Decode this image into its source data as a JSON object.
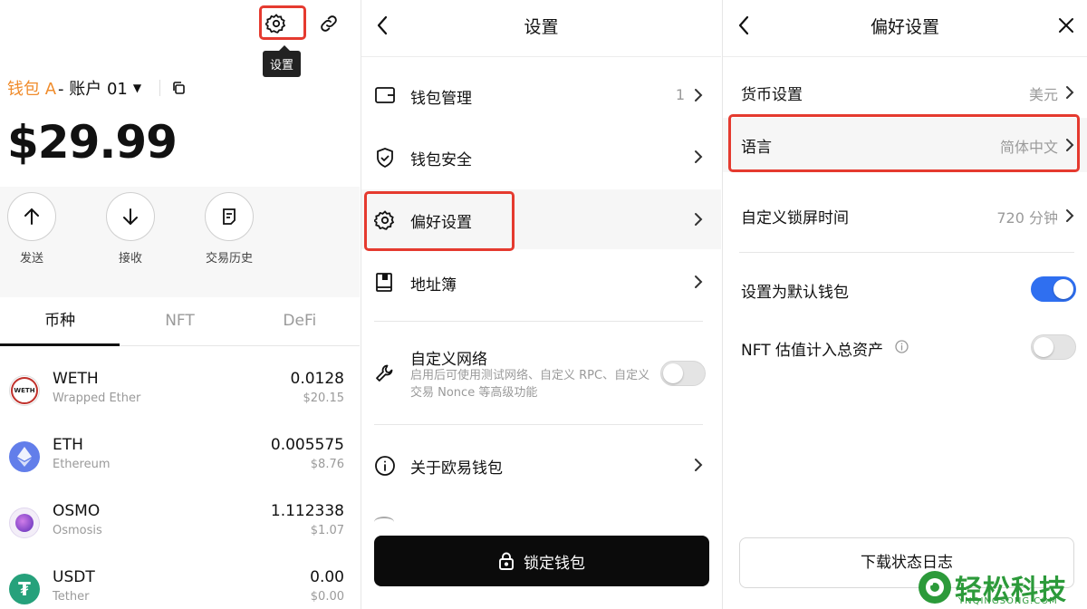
{
  "panel_wallet": {
    "tooltip": "设置",
    "wallet_name": "钱包 A",
    "account_name": "- 账户 01",
    "balance": "$29.99",
    "actions": [
      {
        "label": "发送",
        "icon": "arrow-up-icon"
      },
      {
        "label": "接收",
        "icon": "arrow-down-icon"
      },
      {
        "label": "交易历史",
        "icon": "history-icon"
      }
    ],
    "tabs": [
      "币种",
      "NFT",
      "DeFi"
    ],
    "active_tab": "币种",
    "tokens": [
      {
        "symbol": "WETH",
        "name": "Wrapped Ether",
        "amount": "0.0128",
        "usd": "$20.15",
        "logo_text": "WETH"
      },
      {
        "symbol": "ETH",
        "name": "Ethereum",
        "amount": "0.005575",
        "usd": "$8.76",
        "logo_text": ""
      },
      {
        "symbol": "OSMO",
        "name": "Osmosis",
        "amount": "1.112338",
        "usd": "$1.07",
        "logo_text": ""
      },
      {
        "symbol": "USDT",
        "name": "Tether",
        "amount": "0.00",
        "usd": "$0.00",
        "logo_text": "₮"
      }
    ]
  },
  "panel_settings": {
    "title": "设置",
    "items": [
      {
        "label": "钱包管理",
        "value": "1",
        "icon": "wallet-icon"
      },
      {
        "label": "钱包安全",
        "value": "",
        "icon": "shield-icon"
      },
      {
        "label": "偏好设置",
        "value": "",
        "icon": "gear-icon"
      },
      {
        "label": "地址簿",
        "value": "",
        "icon": "address-book-icon"
      }
    ],
    "custom_network": {
      "label": "自定义网络",
      "description": "启用后可使用测试网络、自定义 RPC、自定义交易 Nonce 等高级功能",
      "enabled": false
    },
    "about": {
      "label": "关于欧易钱包"
    },
    "lock_button": "锁定钱包"
  },
  "panel_preferences": {
    "title": "偏好设置",
    "items": [
      {
        "label": "货币设置",
        "value": "美元"
      },
      {
        "label": "语言",
        "value": "简体中文"
      },
      {
        "label": "自定义锁屏时间",
        "value": "720 分钟"
      }
    ],
    "default_wallet": {
      "label": "设置为默认钱包",
      "enabled": true
    },
    "nft_valuation": {
      "label": "NFT 估值计入总资产",
      "enabled": false
    },
    "log_button": "下载状态日志"
  },
  "watermark": {
    "text": "轻松科技",
    "sub": "YNQINGSONG.COM"
  },
  "colors": {
    "accent_orange": "#f08c2c",
    "highlight_red": "#e53a2f",
    "toggle_blue": "#2f6ff0",
    "brand_green": "#2c9a3a"
  }
}
